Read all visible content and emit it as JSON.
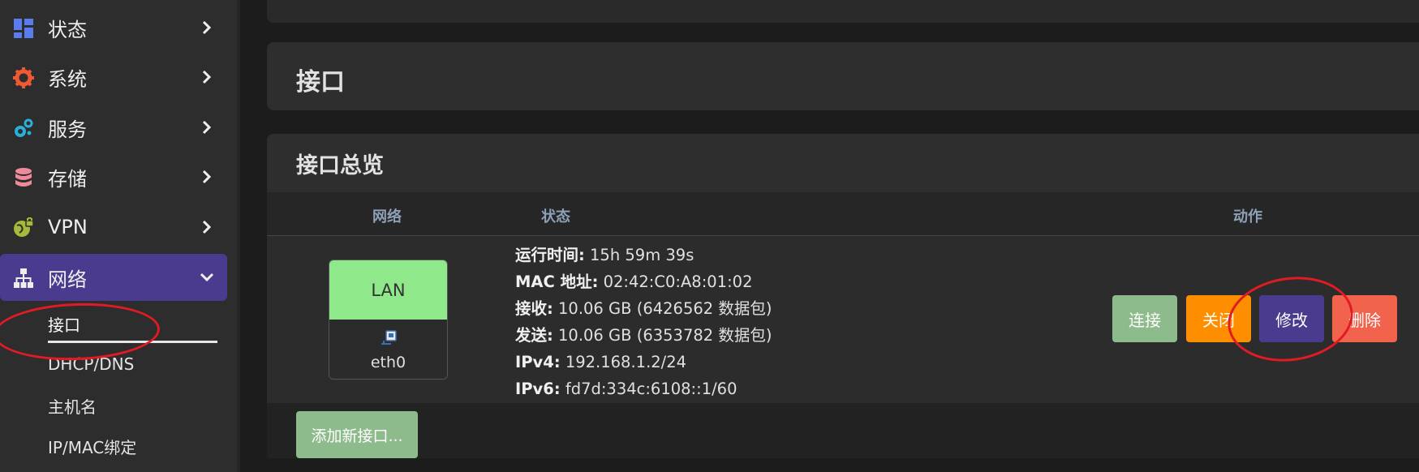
{
  "sidebar": {
    "items": [
      {
        "label": "状态",
        "icon": "dashboard-icon"
      },
      {
        "label": "系统",
        "icon": "gear-icon"
      },
      {
        "label": "服务",
        "icon": "cogs-icon"
      },
      {
        "label": "存储",
        "icon": "database-icon"
      },
      {
        "label": "VPN",
        "icon": "globe-lock-icon"
      },
      {
        "label": "网络",
        "icon": "sitemap-icon"
      }
    ],
    "subitems": [
      {
        "label": "接口"
      },
      {
        "label": "DHCP/DNS"
      },
      {
        "label": "主机名"
      },
      {
        "label": "IP/MAC绑定"
      }
    ]
  },
  "main": {
    "page_title": "接口",
    "section_title": "接口总览",
    "columns": {
      "network": "网络",
      "status": "状态",
      "actions": "动作"
    },
    "interface": {
      "name": "LAN",
      "device": "eth0",
      "badge_color": "#8fe98a",
      "status": [
        {
          "key": "运行时间:",
          "value": " 15h 59m 39s"
        },
        {
          "key": "MAC 地址:",
          "value": " 02:42:C0:A8:01:02"
        },
        {
          "key": "接收:",
          "value": " 10.06 GB (6426562 数据包)"
        },
        {
          "key": "发送:",
          "value": " 10.06 GB (6353782 数据包)"
        },
        {
          "key": "IPv4:",
          "value": " 192.168.1.2/24"
        },
        {
          "key": "IPv6:",
          "value": " fd7d:334c:6108::1/60"
        }
      ]
    },
    "actions": {
      "connect": "连接",
      "stop": "关闭",
      "edit": "修改",
      "delete": "删除"
    },
    "add_button": "添加新接口..."
  },
  "colors": {
    "accent": "#4a3b8f",
    "connect": "#8dbb8b",
    "stop": "#fd8e00",
    "delete": "#f2634e",
    "annotation": "#e01b24"
  }
}
